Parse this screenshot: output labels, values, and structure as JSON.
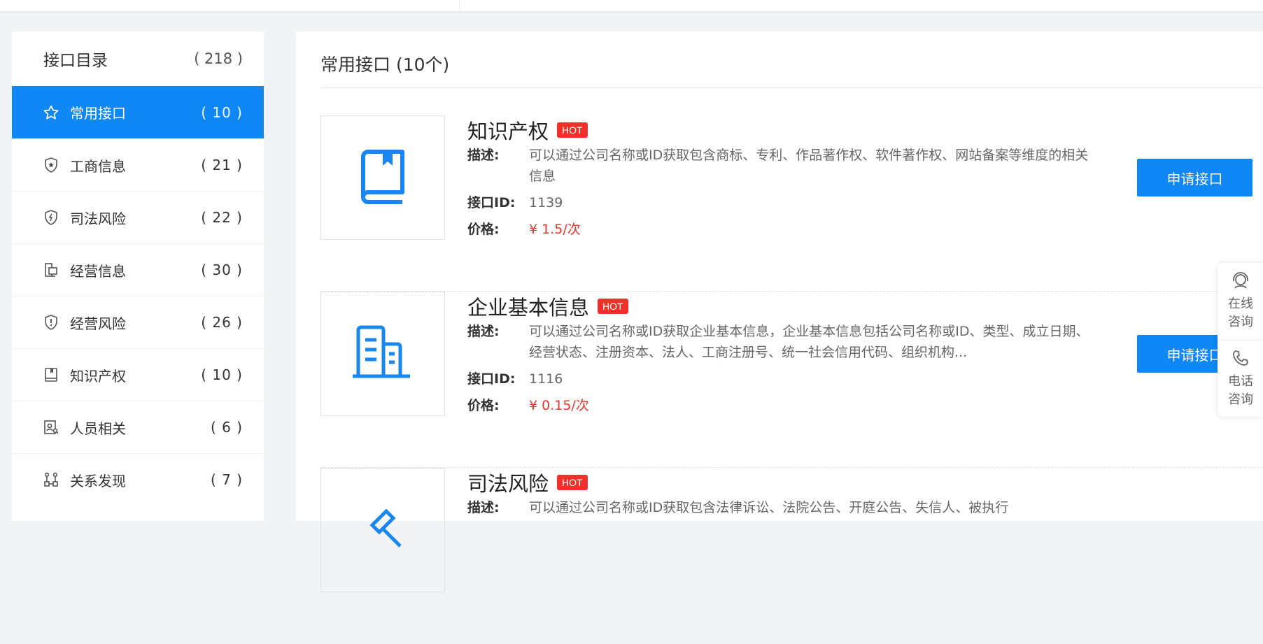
{
  "sidebar": {
    "title": "接口目录",
    "total": "( 218 )",
    "items": [
      {
        "label": "常用接口",
        "count": "( 10 )",
        "icon": "star-icon"
      },
      {
        "label": "工商信息",
        "count": "( 21 )",
        "icon": "badge-icon"
      },
      {
        "label": "司法风险",
        "count": "( 22 )",
        "icon": "shield-icon"
      },
      {
        "label": "经营信息",
        "count": "( 30 )",
        "icon": "device-icon"
      },
      {
        "label": "经营风险",
        "count": "( 26 )",
        "icon": "alert-shield-icon"
      },
      {
        "label": "知识产权",
        "count": "( 10 )",
        "icon": "book-icon"
      },
      {
        "label": "人员相关",
        "count": "( 6 )",
        "icon": "person-search-icon"
      },
      {
        "label": "关系发现",
        "count": "( 7 )",
        "icon": "relation-icon"
      }
    ]
  },
  "main": {
    "title": "常用接口 (10个)",
    "labels": {
      "desc": "描述:",
      "id": "接口ID:",
      "price": "价格:",
      "hot": "HOT",
      "apply": "申请接口"
    },
    "cards": [
      {
        "name": "知识产权",
        "desc": "可以通过公司名称或ID获取包含商标、专利、作品著作权、软件著作权、网站备案等维度的相关信息",
        "id": "1139",
        "price": "¥ 1.5/次",
        "icon": "book-icon"
      },
      {
        "name": "企业基本信息",
        "desc": "可以通过公司名称或ID获取企业基本信息，企业基本信息包括公司名称或ID、类型、成立日期、经营状态、注册资本、法人、工商注册号、统一社会信用代码、组织机构...",
        "id": "1116",
        "price": "¥ 0.15/次",
        "icon": "building-icon"
      },
      {
        "name": "司法风险",
        "desc": "可以通过公司名称或ID获取包含法律诉讼、法院公告、开庭公告、失信人、被执行",
        "id": "",
        "price": "",
        "icon": "gavel-icon"
      }
    ]
  },
  "float": {
    "online": "在线咨询",
    "phone": "电话咨询"
  },
  "colors": {
    "accent": "#0f87f5",
    "hot": "#f0302b",
    "price": "#e8362e"
  }
}
